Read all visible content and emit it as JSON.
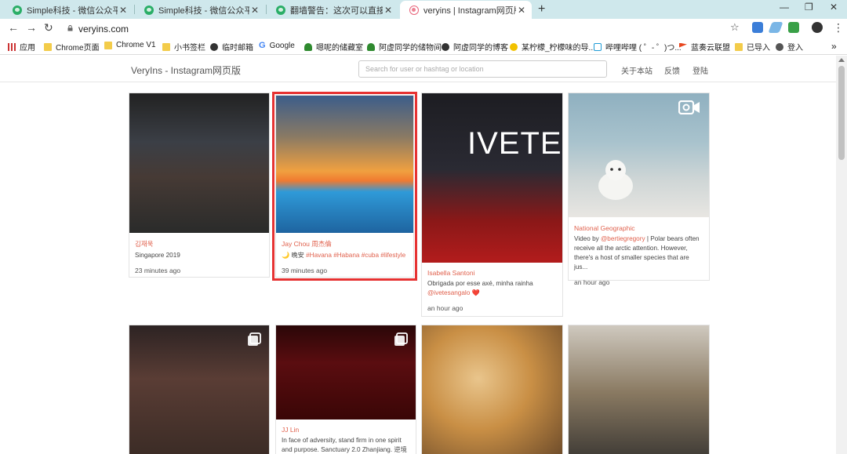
{
  "browser": {
    "tabs": [
      {
        "title": "Simple科技 - 微信公众平台"
      },
      {
        "title": "Simple科技 - 微信公众平台"
      },
      {
        "title": "翻墙警告：这次可以直接访问ins"
      },
      {
        "title": "veryins | Instagram网页版发现"
      }
    ],
    "new_tab": "+",
    "window_controls": {
      "minimize": "—",
      "restore": "❐",
      "close": "✕"
    },
    "url": "veryins.com",
    "bookmarks": [
      {
        "label": "应用",
        "icon": "apps-icon"
      },
      {
        "label": "Chrome页面",
        "icon": "folder-icon"
      },
      {
        "label": "Chrome V1",
        "icon": "folder-icon"
      },
      {
        "label": "小书签栏",
        "icon": "folder-icon"
      },
      {
        "label": "临时邮箱",
        "icon": "globe-icon"
      },
      {
        "label": "Google",
        "icon": "google-icon"
      },
      {
        "label": "嗯呢的储藏室",
        "icon": "tree-icon"
      },
      {
        "label": "阿虚同学的储物间",
        "icon": "tree-icon"
      },
      {
        "label": "阿虚同学的博客",
        "icon": "globe-icon"
      },
      {
        "label": "某柠檬_柠檬味的导...",
        "icon": "lemon-icon"
      },
      {
        "label": "哔哩哔哩 ( ゜- ゜)つ...",
        "icon": "bilibili-icon"
      },
      {
        "label": "蓝奏云联盟",
        "icon": "flag-icon"
      },
      {
        "label": "已导入",
        "icon": "folder-icon"
      },
      {
        "label": "登入",
        "icon": "avatar-icon"
      }
    ],
    "bookmarks_overflow": "»"
  },
  "site": {
    "brand": "VeryIns - Instagram网页版",
    "search_placeholder": "Search for user or hashtag or location",
    "nav": {
      "about": "关于本站",
      "feedback": "反馈",
      "login": "登陆"
    }
  },
  "posts": [
    {
      "user": "김재욱",
      "caption": "Singapore 2019",
      "time": "23 minutes ago",
      "media": "photo"
    },
    {
      "user": "Jay Chou 周杰倫",
      "caption_prefix": "🌙 晚安 ",
      "tags": [
        "#Havana",
        "#Habana",
        "#cuba",
        "#lifestyle"
      ],
      "time": "39 minutes ago",
      "media": "photo",
      "highlighted": true
    },
    {
      "user": "Isabella Santoni",
      "caption": "Obrigada por esse axé, minha rainha",
      "mention": "@ivetesangalo",
      "mention_suffix": " ❤️",
      "time": "an hour ago",
      "media": "photo",
      "image_text": "IVETE"
    },
    {
      "user": "National Geographic",
      "caption_prefix": "Video by ",
      "mention": "@bertiegregory",
      "caption_rest": " | Polar bears often receive all the arctic attention. However, there's a host of smaller species that are jus...",
      "time": "an hour ago",
      "media": "video"
    },
    {
      "user": "",
      "caption": "",
      "time": "",
      "media": "carousel"
    },
    {
      "user": "JJ Lin",
      "caption": "In face of adversity, stand firm in one spirit and purpose. Sanctuary 2.0 Zhanjiang. 逆境",
      "time": "",
      "media": "carousel"
    },
    {
      "user": "",
      "caption": "",
      "time": "",
      "media": "photo"
    },
    {
      "user": "",
      "caption": "",
      "time": "",
      "media": "photo"
    }
  ],
  "colors": {
    "accent": "#e0604c",
    "highlight": "#e63232",
    "tabbar": "#cfe8ec"
  }
}
